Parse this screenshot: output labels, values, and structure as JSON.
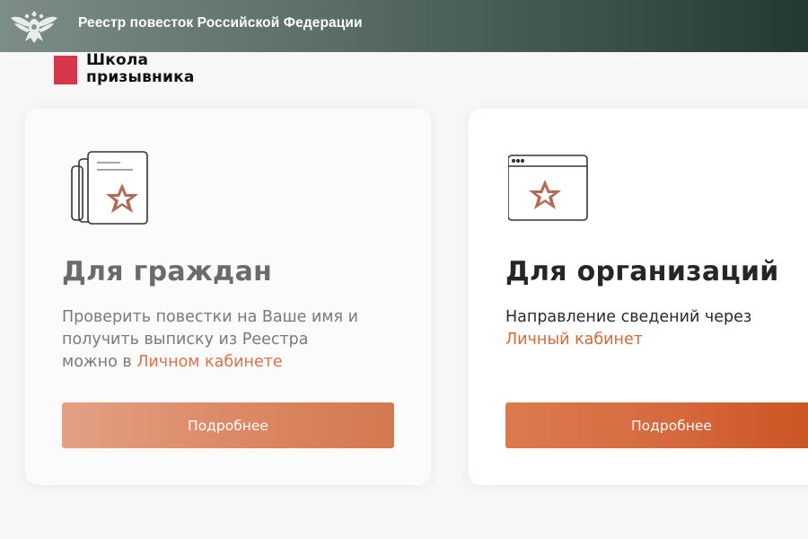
{
  "header": {
    "title": "Реестр повесток Российской Федерации",
    "emblem_icon": "double-headed-eagle-icon"
  },
  "school": {
    "line1": "Школа",
    "line2": "призывника",
    "mark_color": "#d6364a"
  },
  "cards": [
    {
      "icon": "documents-star-icon",
      "title": "Для граждан",
      "desc_line1": "Проверить повестки на Ваше имя и",
      "desc_line2": "получить выписку из Реестра",
      "desc_line3_prefix": "можно в ",
      "link_text": "Личном кабинете",
      "button_label": "Подробнее"
    },
    {
      "icon": "browser-window-star-icon",
      "title": "Для организаций",
      "desc_line1": "Направление сведений через",
      "link_text": "Личный кабинет",
      "button_label": "Подробнее"
    }
  ],
  "colors": {
    "accent": "#d9734a",
    "star": "#b06a55",
    "header_dark": "#22392f"
  }
}
